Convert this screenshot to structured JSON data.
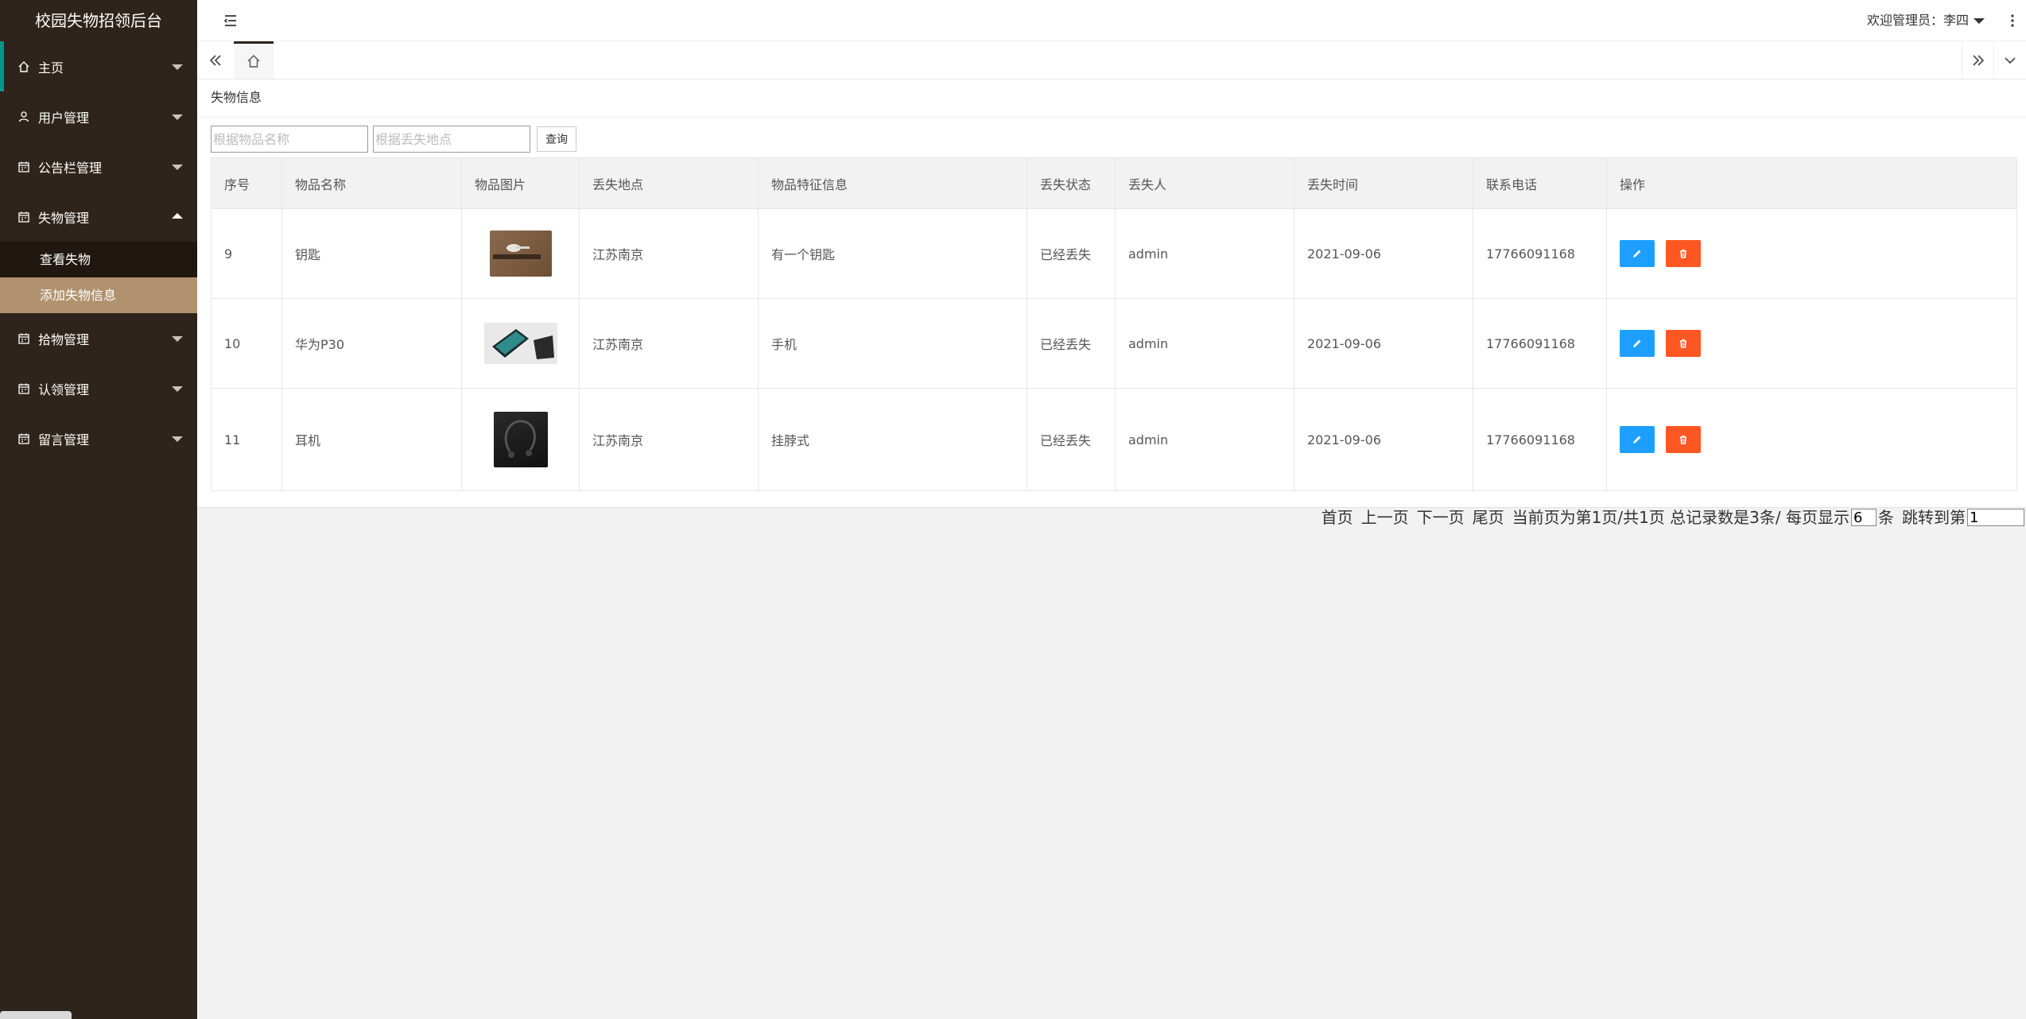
{
  "app": {
    "title": "校园失物招领后台"
  },
  "sidebar": {
    "items": [
      {
        "label": "主页",
        "icon": "home-icon"
      },
      {
        "label": "用户管理",
        "icon": "user-icon"
      },
      {
        "label": "公告栏管理",
        "icon": "calendar-icon"
      },
      {
        "label": "失物管理",
        "icon": "calendar-icon",
        "expanded": true,
        "children": [
          {
            "label": "查看失物"
          },
          {
            "label": "添加失物信息",
            "selected": true
          }
        ]
      },
      {
        "label": "拾物管理",
        "icon": "calendar-icon"
      },
      {
        "label": "认领管理",
        "icon": "calendar-icon"
      },
      {
        "label": "留言管理",
        "icon": "calendar-icon"
      }
    ]
  },
  "header": {
    "welcome": "欢迎管理员：李四"
  },
  "panel": {
    "title": "失物信息"
  },
  "search": {
    "name_placeholder": "根据物品名称",
    "place_placeholder": "根据丢失地点",
    "button_label": "查询"
  },
  "table": {
    "headers": [
      "序号",
      "物品名称",
      "物品图片",
      "丢失地点",
      "物品特征信息",
      "丢失状态",
      "丢失人",
      "丢失时间",
      "联系电话",
      "操作"
    ],
    "rows": [
      {
        "no": "9",
        "name": "钥匙",
        "image": "keys-photo",
        "place": "江苏南京",
        "feature": "有一个钥匙",
        "status": "已经丢失",
        "person": "admin",
        "time": "2021-09-06",
        "phone": "17766091168"
      },
      {
        "no": "10",
        "name": "华为P30",
        "image": "phone-photo",
        "place": "江苏南京",
        "feature": "手机",
        "status": "已经丢失",
        "person": "admin",
        "time": "2021-09-06",
        "phone": "17766091168"
      },
      {
        "no": "11",
        "name": "耳机",
        "image": "earphone-photo",
        "place": "江苏南京",
        "feature": "挂脖式",
        "status": "已经丢失",
        "person": "admin",
        "time": "2021-09-06",
        "phone": "17766091168"
      }
    ]
  },
  "pager": {
    "first": "首页",
    "prev": "上一页",
    "next": "下一页",
    "last": "尾页",
    "info": "当前页为第1页/共1页 总记录数是3条/ 每页显示",
    "page_size": "6",
    "unit": "条",
    "jump_label": "跳转到第",
    "jump_value": "1"
  },
  "colors": {
    "sidebar_bg": "#2f241b",
    "selected_sub": "#b1926f",
    "accent_bar": "#009688",
    "edit": "#1e9fff",
    "delete": "#ff5722"
  }
}
